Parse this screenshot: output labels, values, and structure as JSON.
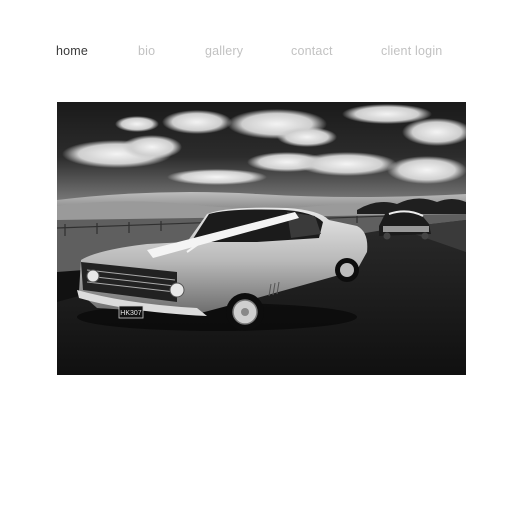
{
  "nav": {
    "items": [
      {
        "label": "home",
        "active": true
      },
      {
        "label": "bio",
        "active": false
      },
      {
        "label": "gallery",
        "active": false
      },
      {
        "label": "contact",
        "active": false
      },
      {
        "label": "client login",
        "active": false
      }
    ]
  },
  "hero": {
    "style": "black-and-white photograph",
    "subject": "vintage coupe with wedding ribbon on a country road",
    "number_plate": "HK307"
  },
  "colors": {
    "nav_active": "#3a3a3a",
    "nav_inactive": "#c2c2c2",
    "background": "#ffffff"
  }
}
